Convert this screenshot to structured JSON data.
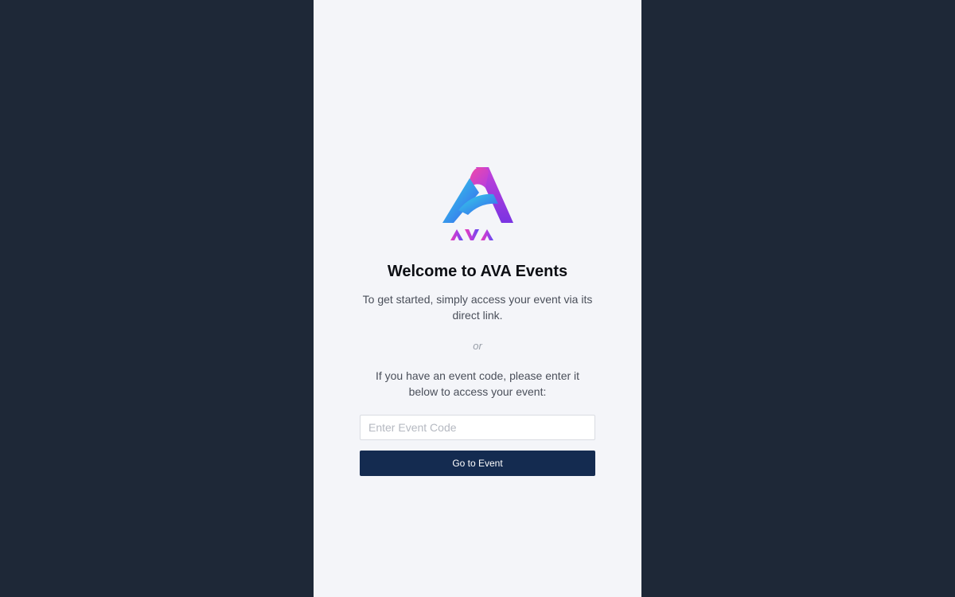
{
  "brand": {
    "logo_text": "AVA",
    "colors": {
      "pink": "#e83ec7",
      "purple": "#8a35e6",
      "cyan": "#2fc4e8",
      "blue": "#3a6ef2"
    }
  },
  "welcome": {
    "title": "Welcome to AVA Events",
    "intro": "To get started, simply access your event via its direct link.",
    "or": "or",
    "code_prompt": "If you have an event code, please enter it below to access your event:"
  },
  "form": {
    "code_input": {
      "value": "",
      "placeholder": "Enter Event Code"
    },
    "submit_label": "Go to Event"
  },
  "theme": {
    "background": "#1e2837",
    "panel": "#f4f5f9",
    "button": "#142b50"
  }
}
